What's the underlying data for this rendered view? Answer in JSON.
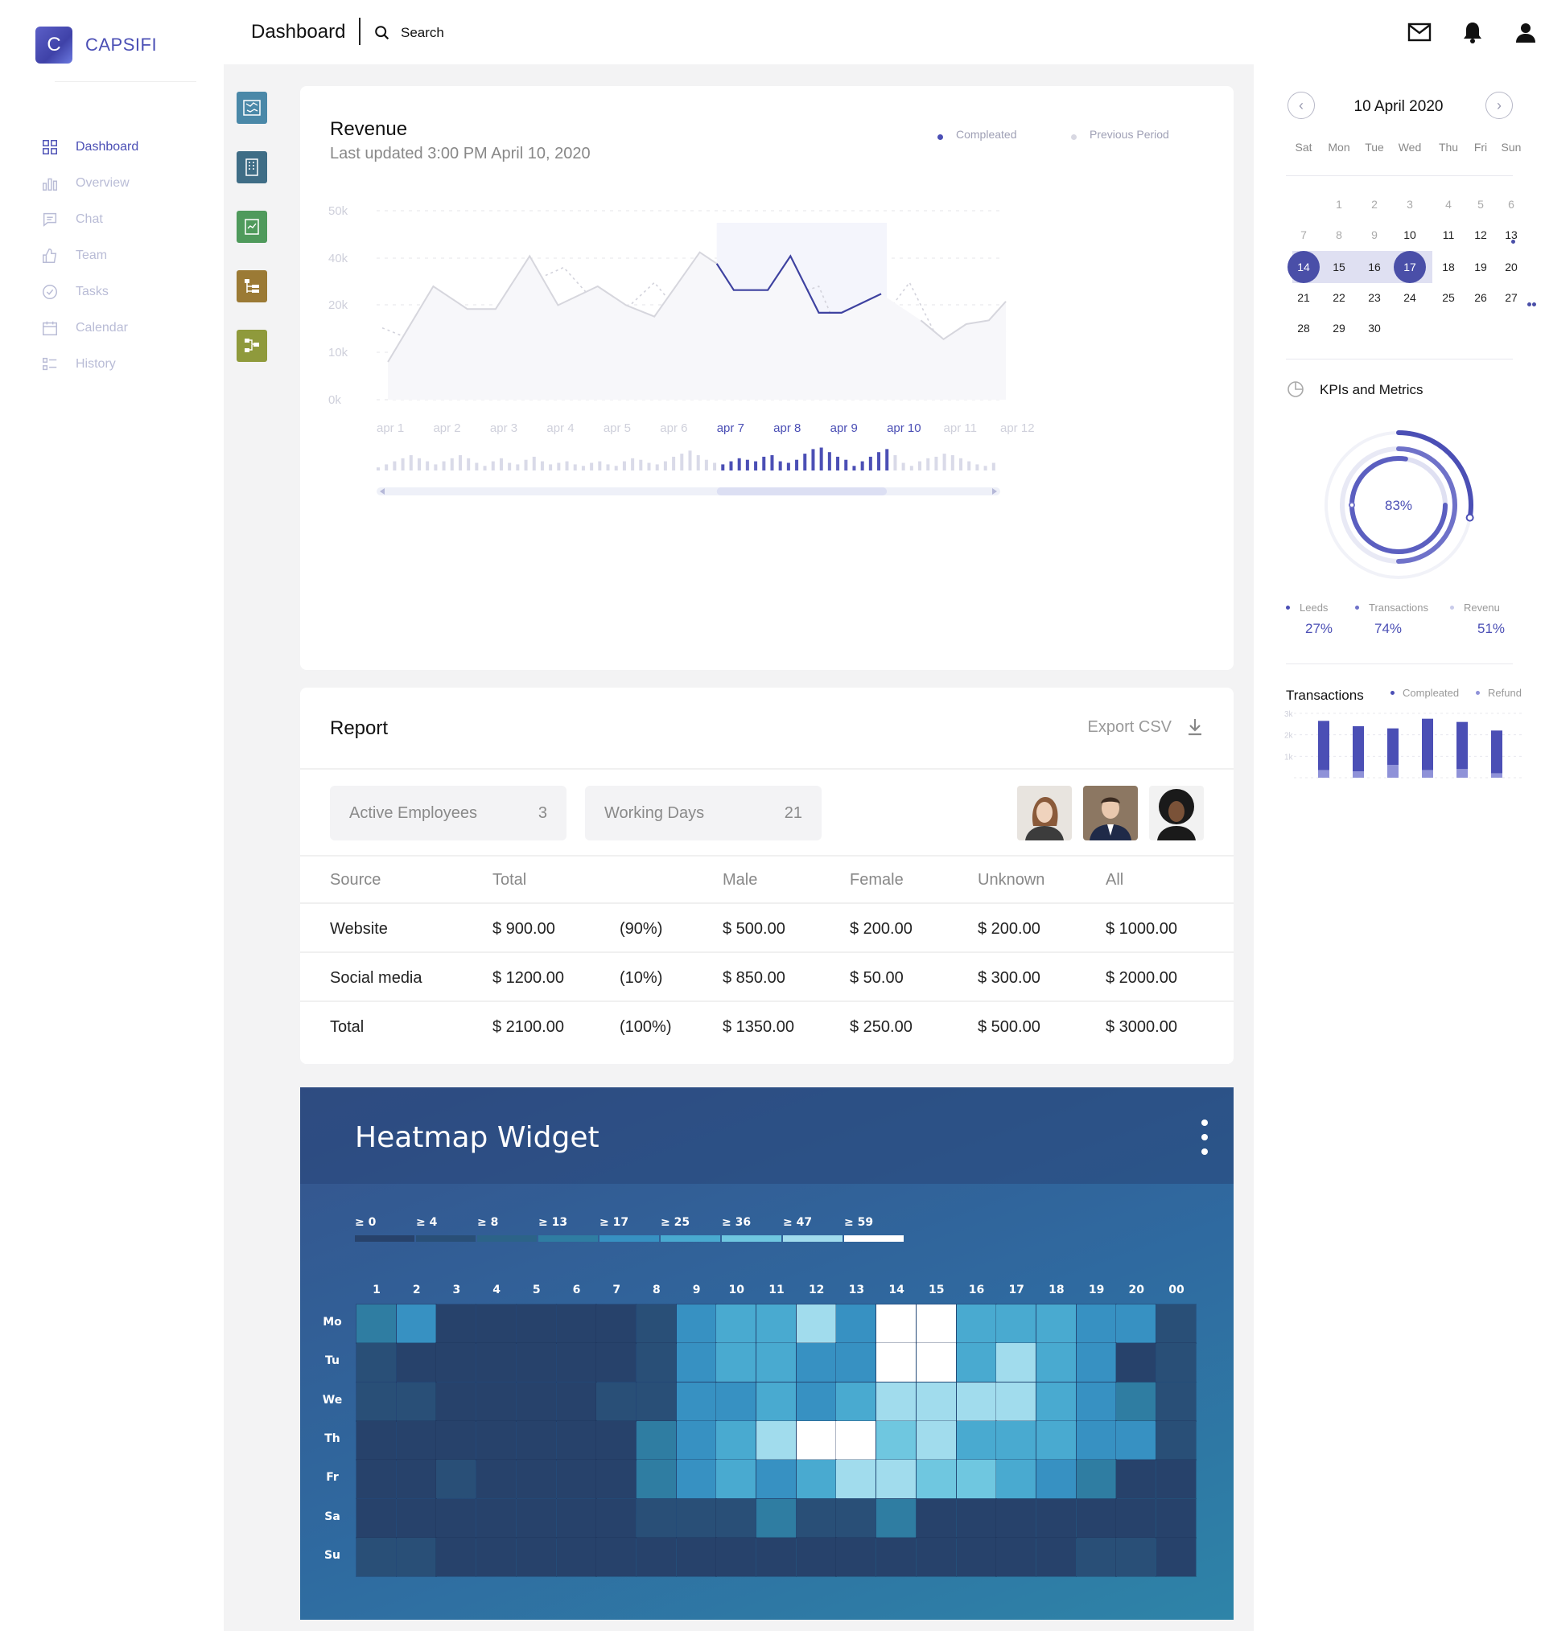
{
  "brand": {
    "logo_letter": "C",
    "name": "CAPSIFI",
    "accent": "#4b4fb5"
  },
  "sidebar": {
    "items": [
      {
        "label": "Dashboard",
        "icon": "grid-icon",
        "active": true
      },
      {
        "label": "Overview",
        "icon": "bar-chart-icon"
      },
      {
        "label": "Chat",
        "icon": "chat-icon"
      },
      {
        "label": "Team",
        "icon": "thumbs-up-icon"
      },
      {
        "label": "Tasks",
        "icon": "check-circle-icon"
      },
      {
        "label": "Calendar",
        "icon": "calendar-icon"
      },
      {
        "label": "History",
        "icon": "list-icon"
      }
    ]
  },
  "header": {
    "title": "Dashboard",
    "search_label": "Search",
    "icons": [
      "mail-icon",
      "bell-icon",
      "user-icon"
    ]
  },
  "app_strip": [
    {
      "icon": "map-app-icon",
      "color": "#4a88a8"
    },
    {
      "icon": "building-app-icon",
      "color": "#3f6d86"
    },
    {
      "icon": "chart-app-icon",
      "color": "#4f9a5c"
    },
    {
      "icon": "tree-app-icon",
      "color": "#9b7a35"
    },
    {
      "icon": "flow-app-icon",
      "color": "#8f9a3c"
    }
  ],
  "revenue": {
    "title": "Revenue",
    "subtitle": "Last updated 3:00 PM April 10, 2020",
    "legend": [
      {
        "label": "Compleated",
        "color": "#4b4fb5"
      },
      {
        "label": "Previous Period",
        "color": "#d8d8e2"
      }
    ],
    "selected_range": [
      "apr 7",
      "apr 10"
    ]
  },
  "chart_data": {
    "type": "line",
    "x": [
      "apr 1",
      "apr 2",
      "apr 3",
      "apr 4",
      "apr 5",
      "apr 6",
      "apr 7",
      "apr 8",
      "apr 9",
      "apr 10",
      "apr 11",
      "apr 12"
    ],
    "y_ticks": [
      "50k",
      "40k",
      "20k",
      "10k",
      "0k"
    ],
    "series": [
      {
        "name": "Compleated",
        "points": [
          [
            0.2,
            10
          ],
          [
            1,
            30
          ],
          [
            1.6,
            24
          ],
          [
            2.1,
            24
          ],
          [
            2.7,
            38
          ],
          [
            3.2,
            25
          ],
          [
            3.9,
            30
          ],
          [
            4.4,
            25
          ],
          [
            4.9,
            22
          ],
          [
            5.7,
            39
          ],
          [
            6,
            36
          ],
          [
            6.3,
            29
          ],
          [
            6.9,
            29
          ],
          [
            7.3,
            38
          ],
          [
            7.8,
            23
          ],
          [
            8.2,
            23
          ],
          [
            8.9,
            28
          ],
          [
            9.6,
            21
          ],
          [
            10,
            16
          ],
          [
            10.4,
            20
          ],
          [
            10.8,
            21
          ],
          [
            11.1,
            26
          ]
        ]
      },
      {
        "name": "Previous Period",
        "points": [
          [
            0.1,
            19
          ],
          [
            0.6,
            16
          ],
          [
            1.1,
            15
          ],
          [
            1.6,
            20
          ],
          [
            2.1,
            15
          ],
          [
            2.7,
            31
          ],
          [
            3.3,
            35
          ],
          [
            3.9,
            25
          ],
          [
            4.4,
            24
          ],
          [
            4.9,
            31
          ],
          [
            5.4,
            22
          ],
          [
            6,
            28
          ],
          [
            6.5,
            18
          ],
          [
            6.9,
            19
          ],
          [
            7.4,
            28
          ],
          [
            7.8,
            30
          ],
          [
            8.2,
            16
          ],
          [
            8.8,
            19
          ],
          [
            9.4,
            31
          ],
          [
            9.9,
            16
          ],
          [
            10.3,
            12
          ],
          [
            10.7,
            17
          ],
          [
            11.1,
            18
          ]
        ]
      }
    ],
    "navigator_bars": [
      2,
      4,
      6,
      8,
      10,
      8,
      6,
      4,
      6,
      8,
      10,
      8,
      5,
      3,
      6,
      8,
      5,
      4,
      7,
      9,
      6,
      4,
      5,
      6,
      4,
      3,
      5,
      6,
      4,
      3,
      6,
      8,
      7,
      5,
      4,
      6,
      9,
      11,
      13,
      10,
      7,
      5,
      4,
      6,
      8,
      7,
      6,
      9,
      10,
      6,
      5,
      7,
      11,
      14,
      15,
      12,
      9,
      7,
      3,
      6,
      9,
      12,
      14,
      10,
      5,
      3,
      6,
      8,
      9,
      11,
      10,
      8,
      6,
      4,
      3,
      5
    ],
    "ylim": [
      0,
      50
    ]
  },
  "report": {
    "title": "Report",
    "export_label": "Export CSV",
    "stats": [
      {
        "label": "Active Employees",
        "value": "3"
      },
      {
        "label": "Working Days",
        "value": "21"
      }
    ],
    "columns": [
      "Source",
      "Total",
      "Male",
      "Female",
      "Unknown",
      "All"
    ],
    "rows": [
      [
        "Website",
        "$ 900.00",
        "(90%)",
        "$ 500.00",
        "$ 200.00",
        "$ 200.00",
        "$ 1000.00"
      ],
      [
        "Social media",
        "$ 1200.00",
        "(10%)",
        "$ 850.00",
        "$ 50.00",
        "$ 300.00",
        "$ 2000.00"
      ],
      [
        "Total",
        "$ 2100.00",
        "(100%)",
        "$ 1350.00",
        "$ 250.00",
        "$ 500.00",
        "$ 3000.00"
      ]
    ]
  },
  "heatmap": {
    "title": "Heatmap Widget",
    "scale": [
      {
        "label": "≥ 0",
        "color": "#27426b"
      },
      {
        "label": "≥ 4",
        "color": "#294f77"
      },
      {
        "label": "≥ 8",
        "color": "#2c6388"
      },
      {
        "label": "≥ 13",
        "color": "#2f7da2"
      },
      {
        "label": "≥ 17",
        "color": "#3791c2"
      },
      {
        "label": "≥ 25",
        "color": "#49aad0"
      },
      {
        "label": "≥ 36",
        "color": "#6fc7e0"
      },
      {
        "label": "≥ 47",
        "color": "#a1dced"
      },
      {
        "label": "≥ 59",
        "color": "#ffffff"
      }
    ],
    "columns": [
      "1",
      "2",
      "3",
      "4",
      "5",
      "6",
      "7",
      "8",
      "9",
      "10",
      "11",
      "12",
      "13",
      "14",
      "15",
      "16",
      "17",
      "18",
      "19",
      "20",
      "00"
    ],
    "rows": [
      "Mo",
      "Tu",
      "We",
      "Th",
      "Fr",
      "Sa",
      "Su"
    ],
    "values": [
      [
        13,
        17,
        0,
        0,
        0,
        0,
        0,
        4,
        17,
        25,
        25,
        47,
        17,
        59,
        59,
        25,
        25,
        25,
        17,
        17,
        4
      ],
      [
        4,
        0,
        0,
        0,
        0,
        0,
        0,
        4,
        17,
        25,
        25,
        17,
        17,
        59,
        59,
        25,
        47,
        25,
        17,
        0,
        4
      ],
      [
        4,
        4,
        0,
        0,
        0,
        0,
        4,
        4,
        17,
        17,
        25,
        17,
        25,
        47,
        47,
        47,
        47,
        25,
        17,
        13,
        4
      ],
      [
        0,
        0,
        0,
        0,
        0,
        0,
        0,
        13,
        17,
        25,
        47,
        59,
        59,
        36,
        47,
        25,
        25,
        25,
        17,
        17,
        4
      ],
      [
        0,
        0,
        4,
        0,
        0,
        0,
        0,
        13,
        17,
        25,
        17,
        25,
        47,
        47,
        36,
        36,
        25,
        17,
        13,
        0,
        0
      ],
      [
        0,
        0,
        0,
        0,
        0,
        0,
        0,
        4,
        4,
        4,
        13,
        4,
        4,
        13,
        0,
        0,
        0,
        0,
        0,
        0,
        0
      ],
      [
        4,
        4,
        0,
        0,
        0,
        0,
        0,
        0,
        0,
        0,
        0,
        0,
        0,
        0,
        0,
        0,
        0,
        0,
        4,
        4,
        0
      ]
    ]
  },
  "calendar": {
    "title": "10 April 2020",
    "weekdays": [
      "Sat",
      "Mon",
      "Tue",
      "Wed",
      "Thu",
      "Fri",
      "Sun"
    ],
    "weeks": [
      [
        "",
        "1",
        "2",
        "3",
        "4",
        "5",
        "6"
      ],
      [
        "7",
        "8",
        "9",
        "10",
        "11",
        "12",
        "13"
      ],
      [
        "14",
        "15",
        "16",
        "17",
        "18",
        "19",
        "20"
      ],
      [
        "21",
        "22",
        "23",
        "24",
        "25",
        "26",
        "27"
      ],
      [
        "28",
        "29",
        "30",
        "",
        "",
        "",
        ""
      ]
    ],
    "muted": [
      "1",
      "2",
      "3",
      "4",
      "5",
      "6",
      "7",
      "8",
      "9"
    ],
    "selected": [
      "14",
      "17"
    ],
    "range": [
      "14",
      "17"
    ]
  },
  "kpis": {
    "title": "KPIs and Metrics",
    "center_label": "83%",
    "ring_value": 0.83,
    "metrics": [
      {
        "label": "Leeds",
        "value": "27%",
        "color": "#4b4fb5"
      },
      {
        "label": "Transactions",
        "value": "74%",
        "color": "#6f72c9"
      },
      {
        "label": "Revenu",
        "value": "51%",
        "color": "#c9cbea"
      }
    ]
  },
  "transactions": {
    "title": "Transactions",
    "legend": [
      {
        "label": "Compleated",
        "color": "#4b4fb5"
      },
      {
        "label": "Refund",
        "color": "#8f92d8"
      }
    ],
    "y_ticks": [
      "3k",
      "2k",
      "1k"
    ],
    "completed": [
      2.3,
      2.1,
      1.7,
      2.4,
      2.2,
      2.0
    ],
    "refund": [
      0.35,
      0.3,
      0.6,
      0.35,
      0.4,
      0.2
    ]
  }
}
